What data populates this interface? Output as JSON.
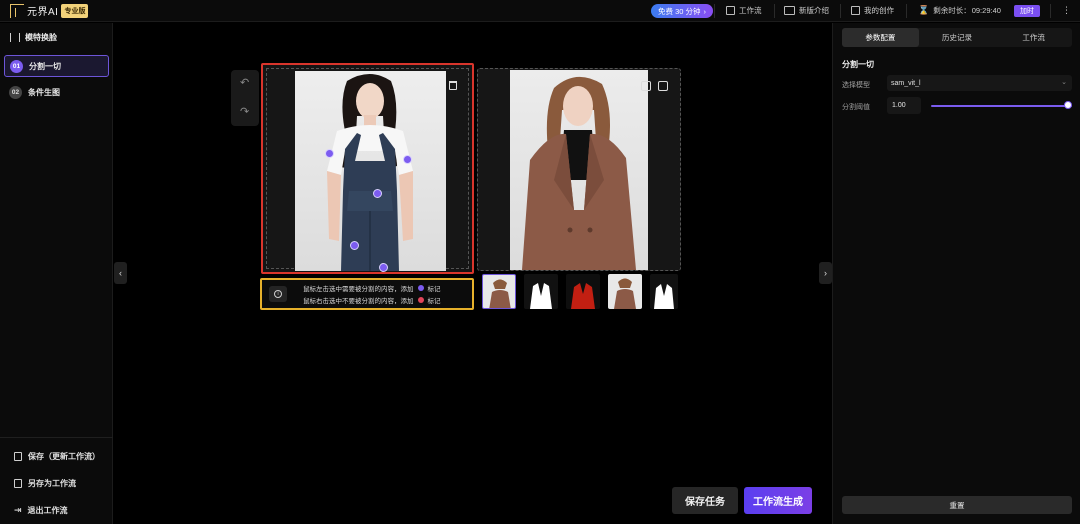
{
  "app": {
    "logo_text": "元界AI",
    "edition_badge": "专业版",
    "free_pill": "免费 30 分钟"
  },
  "topnav": {
    "items": [
      {
        "label": "工作流",
        "icon": "workflow-icon"
      },
      {
        "label": "新版介绍",
        "icon": "new-badge-icon"
      },
      {
        "label": "我的创作",
        "icon": "image-icon"
      }
    ],
    "remaining_label": "剩余时长：",
    "remaining_value": "09:29:40",
    "recharge_label": "加时",
    "more_icon": "more-vertical-icon"
  },
  "sidebar": {
    "title": "模特换脸",
    "steps": [
      {
        "num": "01",
        "label": "分割一切",
        "active": true
      },
      {
        "num": "02",
        "label": "条件生图",
        "active": false
      }
    ],
    "actions": [
      {
        "label": "保存（更新工作流）",
        "icon": "save-icon"
      },
      {
        "label": "另存为工作流",
        "icon": "save-as-icon"
      },
      {
        "label": "退出工作流",
        "icon": "logout-icon"
      }
    ]
  },
  "canvas": {
    "undo_icon": "undo-icon",
    "redo_icon": "redo-icon",
    "hint": {
      "line1": "鼠标左击选中需要被分割的内容，添加",
      "line1_tag": "标记",
      "line2": "鼠标右击选中不要被分割的内容，添加",
      "line2_tag": "标记",
      "positive_color": "#7c5cf0",
      "negative_color": "#e2455a"
    }
  },
  "buttons": {
    "save_task": "保存任务",
    "generate": "工作流生成"
  },
  "right_panel": {
    "tabs": [
      "参数配置",
      "历史记录",
      "工作流"
    ],
    "active_tab": 0,
    "section_title": "分割一切",
    "model_label": "选择模型",
    "model_value": "sam_vit_l",
    "threshold_label": "分割阈值",
    "threshold_value": "1.00",
    "threshold_fraction": 1.0,
    "reset_label": "重置"
  },
  "colors": {
    "accent": "#7b5cf0",
    "active_frame": "#d9352c",
    "hint_frame": "#e6b12b"
  }
}
